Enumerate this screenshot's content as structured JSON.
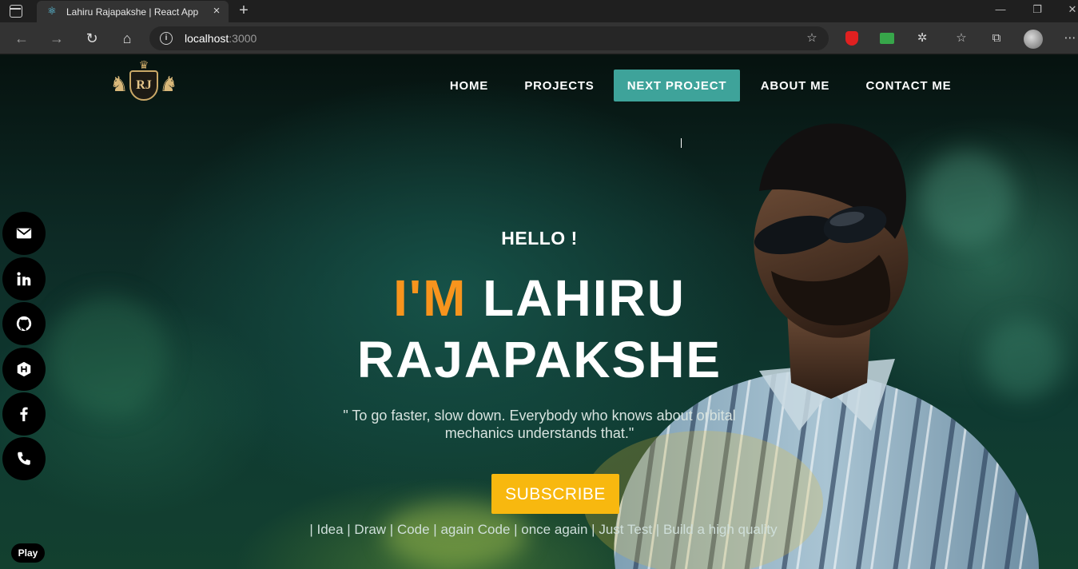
{
  "browser": {
    "tab_title": "Lahiru Rajapakshe | React App",
    "url_host": "localhost",
    "url_port": ":3000"
  },
  "icons": {
    "tab_favicon": "react-icon",
    "tab_close": "close-icon",
    "new_tab": "plus-icon",
    "back": "arrow-left-icon",
    "forward": "arrow-right-icon",
    "refresh": "refresh-icon",
    "home": "home-icon",
    "info": "info-icon",
    "favorite_add": "star-add-icon",
    "extensions": "puzzle-icon",
    "favorites": "favorites-icon",
    "collections": "collections-icon",
    "more": "more-icon"
  },
  "site": {
    "logo_text": "RJ",
    "nav": [
      {
        "label": "HOME"
      },
      {
        "label": "PROJECTS"
      },
      {
        "label": "NEXT PROJECT"
      },
      {
        "label": "ABOUT ME"
      },
      {
        "label": "CONTACT ME"
      }
    ],
    "socials": [
      "mail-icon",
      "linkedin-icon",
      "github-icon",
      "hackerrank-icon",
      "facebook-icon",
      "phone-icon"
    ],
    "hero": {
      "greeting": "HELLO !",
      "im": "I'M",
      "first_name": "LAHIRU",
      "last_name": "RAJAPAKSHE",
      "quote_line1": "\" To go faster, slow down. Everybody who knows about orbital",
      "quote_line2": "mechanics understands that.\"",
      "cta": "SUBSCRIBE",
      "tagline": "| Idea | Draw | Code | again Code | once again | Just Test | Build a high quality"
    }
  },
  "overlay": {
    "play_label": "Play"
  },
  "colors": {
    "accent_orange": "#f7941d",
    "nav_active": "#3ea39a",
    "cta_yellow": "#f8b80f"
  }
}
